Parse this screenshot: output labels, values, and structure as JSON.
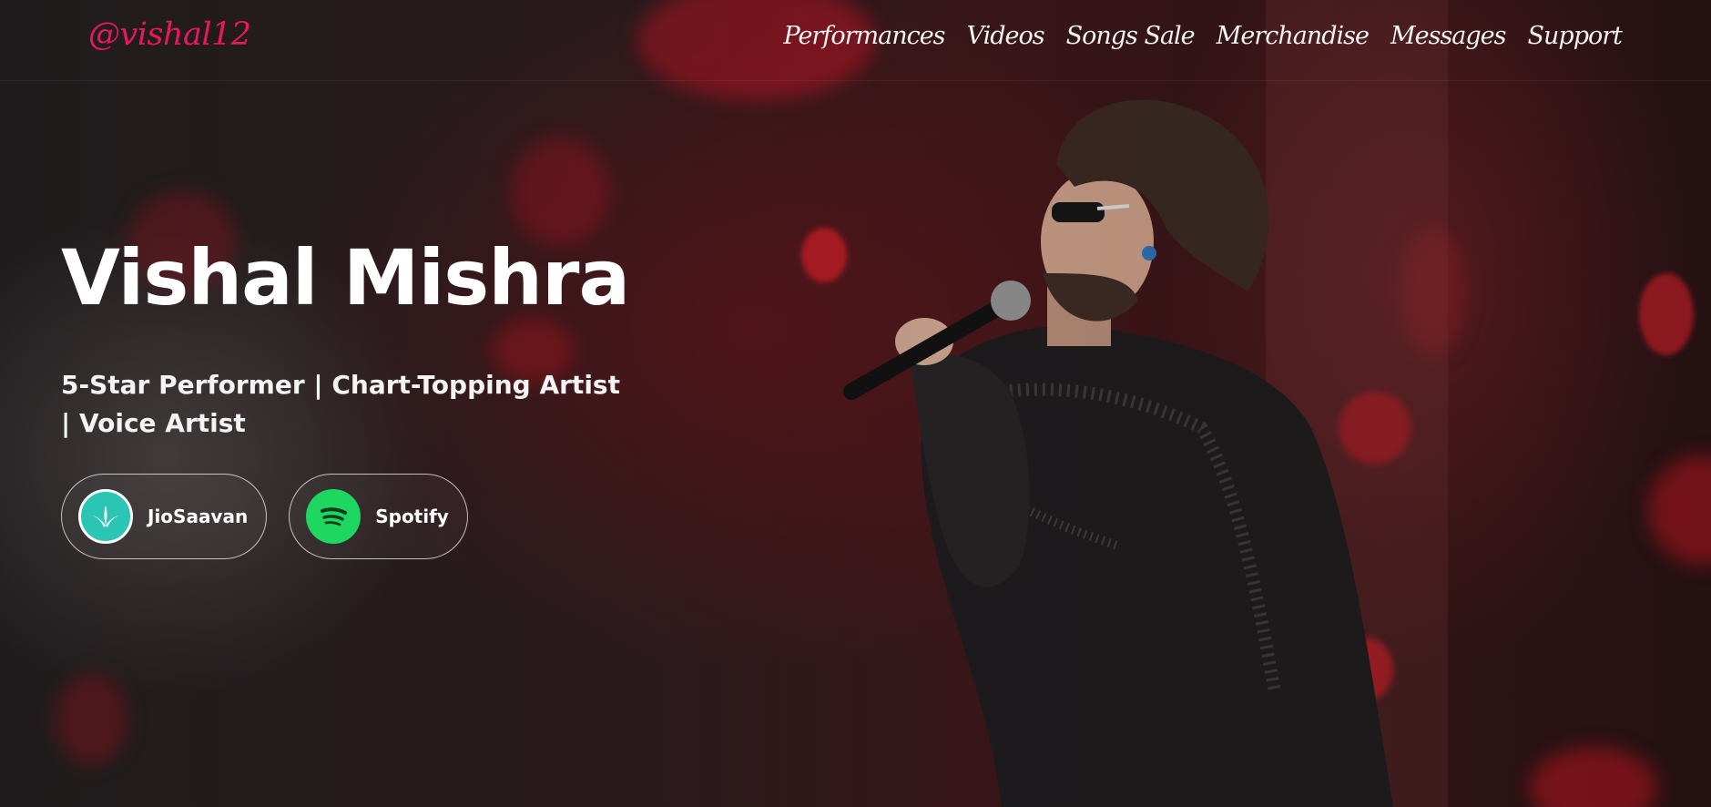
{
  "header": {
    "logo": "@vishal12",
    "nav": [
      "Performances",
      "Videos",
      "Songs Sale",
      "Merchandise",
      "Messages",
      "Support"
    ]
  },
  "hero": {
    "title": "Vishal Mishra",
    "tagline": "5-Star Performer | Chart-Topping Artist | Voice Artist",
    "platforms": [
      {
        "label": "JioSaavan",
        "icon": "jiosaavn-icon",
        "color": "#2bc5b4"
      },
      {
        "label": "Spotify",
        "icon": "spotify-icon",
        "color": "#1ed760"
      }
    ]
  },
  "colors": {
    "accent": "#e8185f",
    "background": "#1a1415"
  }
}
